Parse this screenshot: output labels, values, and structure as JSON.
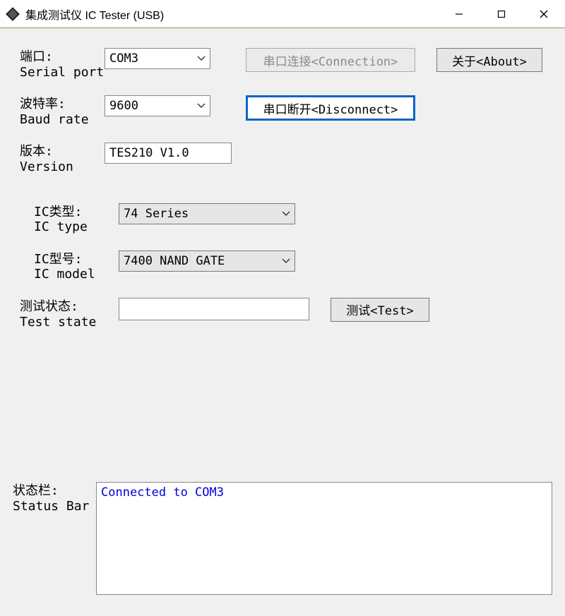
{
  "window": {
    "title": "集成测试仪 IC Tester (USB)"
  },
  "labels": {
    "serial_port_cn": "端口:",
    "serial_port_en": "Serial port",
    "baud_rate_cn": "波特率:",
    "baud_rate_en": "Baud rate",
    "version_cn": "版本:",
    "version_en": "Version",
    "ic_type_cn": "IC类型:",
    "ic_type_en": "IC type",
    "ic_model_cn": "IC型号:",
    "ic_model_en": "IC model",
    "test_state_cn": "测试状态:",
    "test_state_en": "Test state",
    "status_bar_cn": "状态栏:",
    "status_bar_en": "Status Bar"
  },
  "values": {
    "serial_port": "COM3",
    "baud_rate": "9600",
    "version": "TES210 V1.0",
    "ic_type": "74 Series",
    "ic_model": "7400 NAND GATE",
    "test_state": ""
  },
  "buttons": {
    "connect": "串口连接<Connection>",
    "disconnect": "串口断开<Disconnect>",
    "about": "关于<About>",
    "test": "测试<Test>"
  },
  "status": {
    "text": "Connected to COM3"
  }
}
